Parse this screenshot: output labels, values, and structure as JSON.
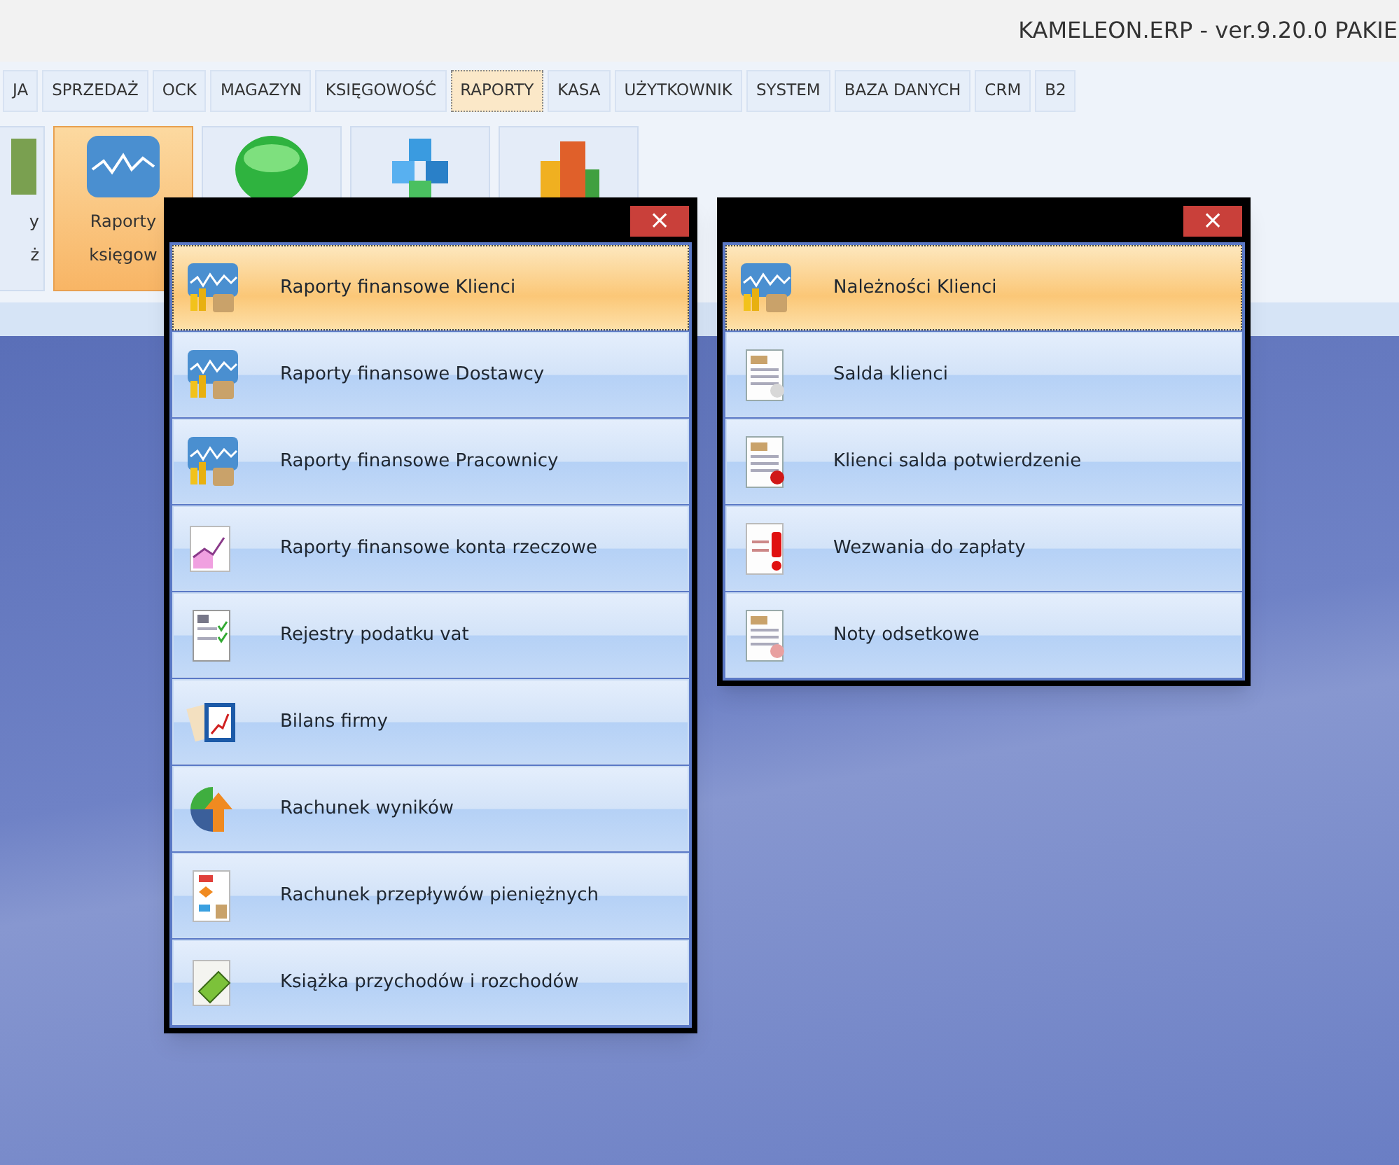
{
  "window": {
    "title": "KAMELEON.ERP - ver.9.20.0 PAKIE"
  },
  "tabs": [
    {
      "label": "JA",
      "selected": false
    },
    {
      "label": "SPRZEDAŻ",
      "selected": false
    },
    {
      "label": "OCK",
      "selected": false
    },
    {
      "label": "MAGAZYN",
      "selected": false
    },
    {
      "label": "KSIĘGOWOŚĆ",
      "selected": false
    },
    {
      "label": "RAPORTY",
      "selected": true
    },
    {
      "label": "KASA",
      "selected": false
    },
    {
      "label": "UŻYTKOWNIK",
      "selected": false
    },
    {
      "label": "SYSTEM",
      "selected": false
    },
    {
      "label": "BAZA DANYCH",
      "selected": false
    },
    {
      "label": "CRM",
      "selected": false
    },
    {
      "label": "B2",
      "selected": false
    }
  ],
  "ribbon": {
    "buttons": [
      {
        "lines": [
          "y",
          "ż"
        ],
        "selected": false
      },
      {
        "lines": [
          "Raporty",
          "księgow"
        ],
        "selected": true
      },
      {
        "selected": false
      },
      {
        "selected": false
      },
      {
        "selected": false
      }
    ]
  },
  "menus": [
    {
      "close": "×",
      "items": [
        {
          "label": "Raporty finansowe Klienci",
          "selected": true
        },
        {
          "label": "Raporty finansowe Dostawcy",
          "selected": false
        },
        {
          "label": "Raporty finansowe Pracownicy",
          "selected": false
        },
        {
          "label": "Raporty finansowe konta rzeczowe",
          "selected": false
        },
        {
          "label": "Rejestry podatku vat",
          "selected": false
        },
        {
          "label": "Bilans firmy",
          "selected": false
        },
        {
          "label": "Rachunek wyników",
          "selected": false
        },
        {
          "label": "Rachunek przepływów pieniężnych",
          "selected": false
        },
        {
          "label": "Książka przychodów i rozchodów",
          "selected": false
        }
      ]
    },
    {
      "close": "×",
      "items": [
        {
          "label": "Należności Klienci",
          "selected": true
        },
        {
          "label": "Salda klienci",
          "selected": false
        },
        {
          "label": "Klienci salda potwierdzenie",
          "selected": false
        },
        {
          "label": "Wezwania do zapłaty",
          "selected": false
        },
        {
          "label": "Noty odsetkowe",
          "selected": false
        }
      ]
    }
  ]
}
